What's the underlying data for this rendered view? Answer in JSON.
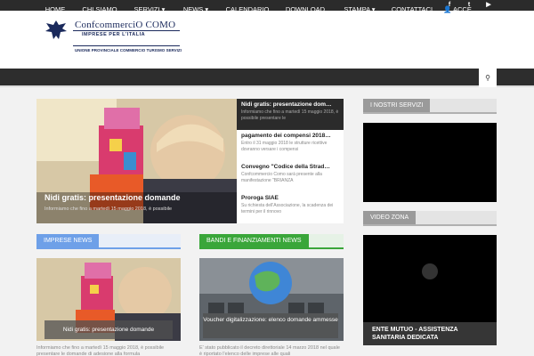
{
  "topbar": {
    "social": [
      {
        "icon": "facebook-icon",
        "glyph": "f"
      },
      {
        "icon": "twitter-icon",
        "glyph": "t"
      },
      {
        "icon": "youtube-icon",
        "glyph": "▶"
      }
    ]
  },
  "logo": {
    "name": "ConfcommerciO COMO",
    "subtitle": "IMPRESE PER L'ITALIA",
    "tagline": "UNIONE PROVINCIALE COMMERCIO TURISMO SERVIZI"
  },
  "nav": {
    "items": [
      {
        "label": "HOME"
      },
      {
        "label": "CHI SIAMO"
      },
      {
        "label": "SERVIZI ▾"
      },
      {
        "label": "NEWS ▾"
      },
      {
        "label": "CALENDARIO"
      },
      {
        "label": "DOWNLOAD"
      },
      {
        "label": "STAMPA ▾"
      },
      {
        "label": "CONTATTACI"
      },
      {
        "label": "👤 ACCE"
      }
    ],
    "search_icon": "⚲"
  },
  "slider": {
    "caption": "Nidi gratis: presentazione domande",
    "excerpt": "Informiamo che fino a martedì 15 maggio 2018, è possibile"
  },
  "side_news": [
    {
      "title": "Nidi gratis: presentazione dom…",
      "excerpt": "Informiamo che fino a martedì 15 maggio 2018, è possibile presentare le"
    },
    {
      "title": "pagamento dei compensi 2018…",
      "excerpt": "Entro il 31 maggio 2018 le strutture ricettive dovranno versare i compensi"
    },
    {
      "title": "Convegno \"Codice della Strad…",
      "excerpt": "Confcommercio Como sarà presente alla manifestazione \"BRIANZA"
    },
    {
      "title": "Proroga SIAE",
      "excerpt": "Su richiesta dell'Associazione, la scadenza dei termini per il rinnovo"
    }
  ],
  "sections": {
    "servizi": {
      "label": "I NOSTRI SERVIZI",
      "color": "#b0b0b0"
    },
    "video": {
      "label": "VIDEO ZONA",
      "color": "#b0b0b0"
    },
    "imprese": {
      "label": "IMPRESE NEWS",
      "color": "#6ea0e8"
    },
    "bandi": {
      "label": "BANDI E FINANZIAMENTI NEWS",
      "color": "#3aa63a"
    }
  },
  "cards": {
    "imprese": {
      "caption": "Nidi gratis: presentazione domande",
      "excerpt": "Informiamo che fino a martedì 15 maggio 2018, è possibile presentare le domande di adesione alla formula"
    },
    "bandi": {
      "caption": "Voucher digitalizzazione: elenco domande ammesse",
      "excerpt": "E' stato pubblicato il decreto direttoriale 14 marzo 2018 nel quale è riportato l'elenco delle imprese alle quali"
    }
  },
  "video_caption": "ENTE MUTUO - ASSISTENZA SANITARIA DEDICATA"
}
